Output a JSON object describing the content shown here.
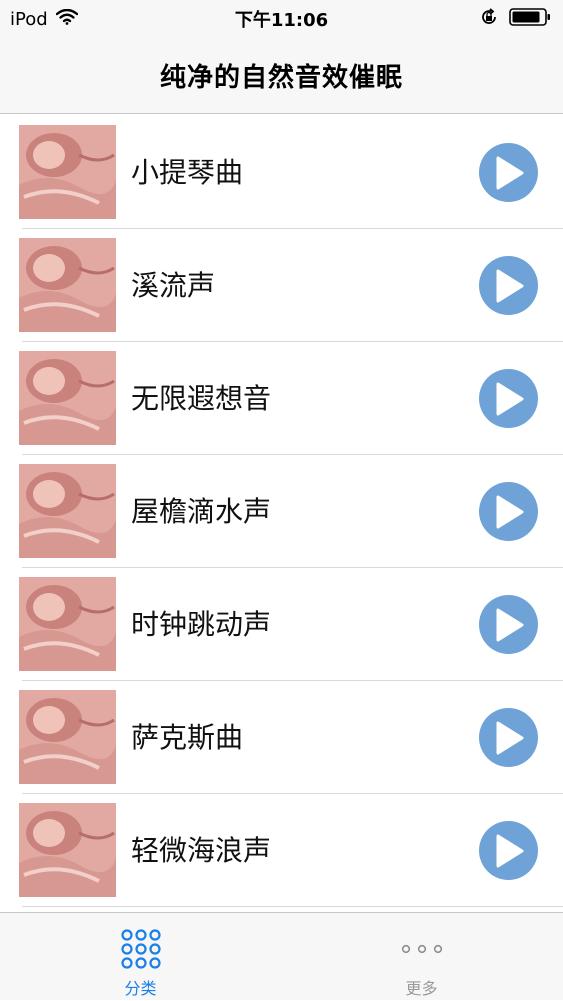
{
  "status_bar": {
    "carrier": "iPod",
    "time": "下午11:06"
  },
  "nav": {
    "title": "纯净的自然音效催眠"
  },
  "list": {
    "items": [
      {
        "label": "小提琴曲"
      },
      {
        "label": "溪流声"
      },
      {
        "label": "无限遐想音"
      },
      {
        "label": "屋檐滴水声"
      },
      {
        "label": "时钟跳动声"
      },
      {
        "label": "萨克斯曲"
      },
      {
        "label": "轻微海浪声"
      }
    ]
  },
  "tab_bar": {
    "tabs": [
      {
        "label": "分类",
        "icon": "grid-icon",
        "active": true
      },
      {
        "label": "更多",
        "icon": "more-dots-icon",
        "active": false
      }
    ]
  },
  "colors": {
    "accent": "#1a7fe8",
    "play_button": "#6fa3d8"
  }
}
